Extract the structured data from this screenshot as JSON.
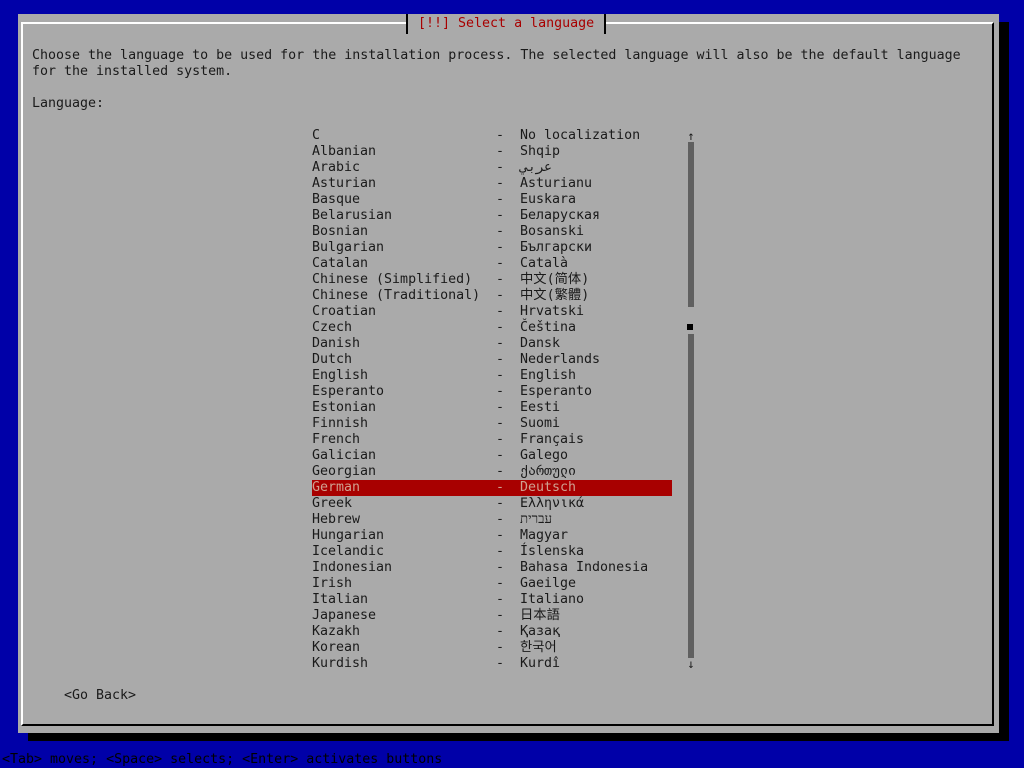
{
  "dialog": {
    "title": "[!!] Select a language",
    "description": "Choose the language to be used for the installation process. The selected language will also be the default language for the installed system.",
    "language_label": "Language:",
    "go_back_label": "<Go Back>"
  },
  "languages": [
    {
      "name": "C",
      "native": "No localization"
    },
    {
      "name": "Albanian",
      "native": "Shqip"
    },
    {
      "name": "Arabic",
      "native": "عربي"
    },
    {
      "name": "Asturian",
      "native": "Asturianu"
    },
    {
      "name": "Basque",
      "native": "Euskara"
    },
    {
      "name": "Belarusian",
      "native": "Беларуская"
    },
    {
      "name": "Bosnian",
      "native": "Bosanski"
    },
    {
      "name": "Bulgarian",
      "native": "Български"
    },
    {
      "name": "Catalan",
      "native": "Català"
    },
    {
      "name": "Chinese (Simplified)",
      "native": "中文(简体)"
    },
    {
      "name": "Chinese (Traditional)",
      "native": "中文(繁體)"
    },
    {
      "name": "Croatian",
      "native": "Hrvatski"
    },
    {
      "name": "Czech",
      "native": "Čeština"
    },
    {
      "name": "Danish",
      "native": "Dansk"
    },
    {
      "name": "Dutch",
      "native": "Nederlands"
    },
    {
      "name": "English",
      "native": "English"
    },
    {
      "name": "Esperanto",
      "native": "Esperanto"
    },
    {
      "name": "Estonian",
      "native": "Eesti"
    },
    {
      "name": "Finnish",
      "native": "Suomi"
    },
    {
      "name": "French",
      "native": "Français"
    },
    {
      "name": "Galician",
      "native": "Galego"
    },
    {
      "name": "Georgian",
      "native": "ქართული"
    },
    {
      "name": "German",
      "native": "Deutsch",
      "selected": true
    },
    {
      "name": "Greek",
      "native": "Ελληνικά"
    },
    {
      "name": "Hebrew",
      "native": "עברית"
    },
    {
      "name": "Hungarian",
      "native": "Magyar"
    },
    {
      "name": "Icelandic",
      "native": "Íslenska"
    },
    {
      "name": "Indonesian",
      "native": "Bahasa Indonesia"
    },
    {
      "name": "Irish",
      "native": "Gaeilge"
    },
    {
      "name": "Italian",
      "native": "Italiano"
    },
    {
      "name": "Japanese",
      "native": "日本語"
    },
    {
      "name": "Kazakh",
      "native": "Қазақ"
    },
    {
      "name": "Korean",
      "native": "한국어"
    },
    {
      "name": "Kurdish",
      "native": "Kurdî"
    }
  ],
  "list_separator": "-",
  "scrollbar": {
    "up_arrow": "↑",
    "down_arrow": "↓"
  },
  "status_bar": "<Tab> moves; <Space> selects; <Enter> activates buttons",
  "colors": {
    "background": "#0000a8",
    "dialog": "#aaaaaa",
    "title_text": "#a80000",
    "selection": "#a80000"
  }
}
